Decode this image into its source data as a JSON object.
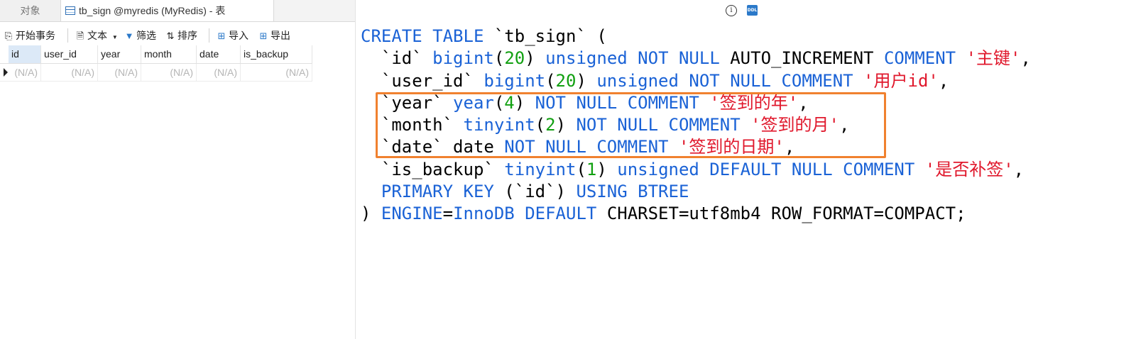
{
  "tabs": {
    "objects_label": "对象",
    "active_label": "tb_sign @myredis (MyRedis) - 表"
  },
  "toolbar": {
    "begin_transaction": "开始事务",
    "text": "文本",
    "filter": "筛选",
    "sort": "排序",
    "import": "导入",
    "export": "导出"
  },
  "grid": {
    "columns": [
      "id",
      "user_id",
      "year",
      "month",
      "date",
      "is_backup"
    ],
    "rows": [
      [
        "(N/A)",
        "(N/A)",
        "(N/A)",
        "(N/A)",
        "(N/A)",
        "(N/A)"
      ]
    ]
  },
  "ddl": {
    "lines": [
      [
        [
          "kw",
          "CREATE TABLE "
        ],
        [
          "plain",
          "`tb_sign` ("
        ]
      ],
      [
        [
          "plain",
          "  `id` "
        ],
        [
          "kw",
          "bigint"
        ],
        [
          "plain",
          "("
        ],
        [
          "num",
          "20"
        ],
        [
          "plain",
          ") "
        ],
        [
          "kw",
          "unsigned NOT NULL "
        ],
        [
          "plain",
          "AUTO_INCREMENT "
        ],
        [
          "kw",
          "COMMENT "
        ],
        [
          "str",
          "'主键'"
        ],
        [
          "plain",
          ","
        ]
      ],
      [
        [
          "plain",
          "  `user_id` "
        ],
        [
          "kw",
          "bigint"
        ],
        [
          "plain",
          "("
        ],
        [
          "num",
          "20"
        ],
        [
          "plain",
          ") "
        ],
        [
          "kw",
          "unsigned NOT NULL COMMENT "
        ],
        [
          "str",
          "'用户id'"
        ],
        [
          "plain",
          ","
        ]
      ],
      [
        [
          "plain",
          "  `year` "
        ],
        [
          "kw",
          "year"
        ],
        [
          "plain",
          "("
        ],
        [
          "num",
          "4"
        ],
        [
          "plain",
          ") "
        ],
        [
          "kw",
          "NOT NULL COMMENT "
        ],
        [
          "str",
          "'签到的年'"
        ],
        [
          "plain",
          ","
        ]
      ],
      [
        [
          "plain",
          "  `month` "
        ],
        [
          "kw",
          "tinyint"
        ],
        [
          "plain",
          "("
        ],
        [
          "num",
          "2"
        ],
        [
          "plain",
          ") "
        ],
        [
          "kw",
          "NOT NULL COMMENT "
        ],
        [
          "str",
          "'签到的月'"
        ],
        [
          "plain",
          ","
        ]
      ],
      [
        [
          "plain",
          "  `date` date "
        ],
        [
          "kw",
          "NOT NULL COMMENT "
        ],
        [
          "str",
          "'签到的日期'"
        ],
        [
          "plain",
          ","
        ]
      ],
      [
        [
          "plain",
          "  `is_backup` "
        ],
        [
          "kw",
          "tinyint"
        ],
        [
          "plain",
          "("
        ],
        [
          "num",
          "1"
        ],
        [
          "plain",
          ") "
        ],
        [
          "kw",
          "unsigned DEFAULT NULL COMMENT "
        ],
        [
          "str",
          "'是否补签'"
        ],
        [
          "plain",
          ","
        ]
      ],
      [
        [
          "kw",
          "  PRIMARY KEY "
        ],
        [
          "plain",
          "(`id`) "
        ],
        [
          "kw",
          "USING BTREE"
        ]
      ],
      [
        [
          "plain",
          ") "
        ],
        [
          "kw",
          "ENGINE"
        ],
        [
          "plain",
          "="
        ],
        [
          "kw",
          "InnoDB DEFAULT "
        ],
        [
          "plain",
          "CHARSET=utf8mb4 ROW_FORMAT=COMPACT;"
        ]
      ]
    ]
  },
  "colors": {
    "keyword": "#1a62d6",
    "number": "#11a011",
    "string": "#e0182c",
    "highlight_box": "#f0812f"
  },
  "icons": {
    "info": "info-icon",
    "ddl": "ddl-icon"
  }
}
